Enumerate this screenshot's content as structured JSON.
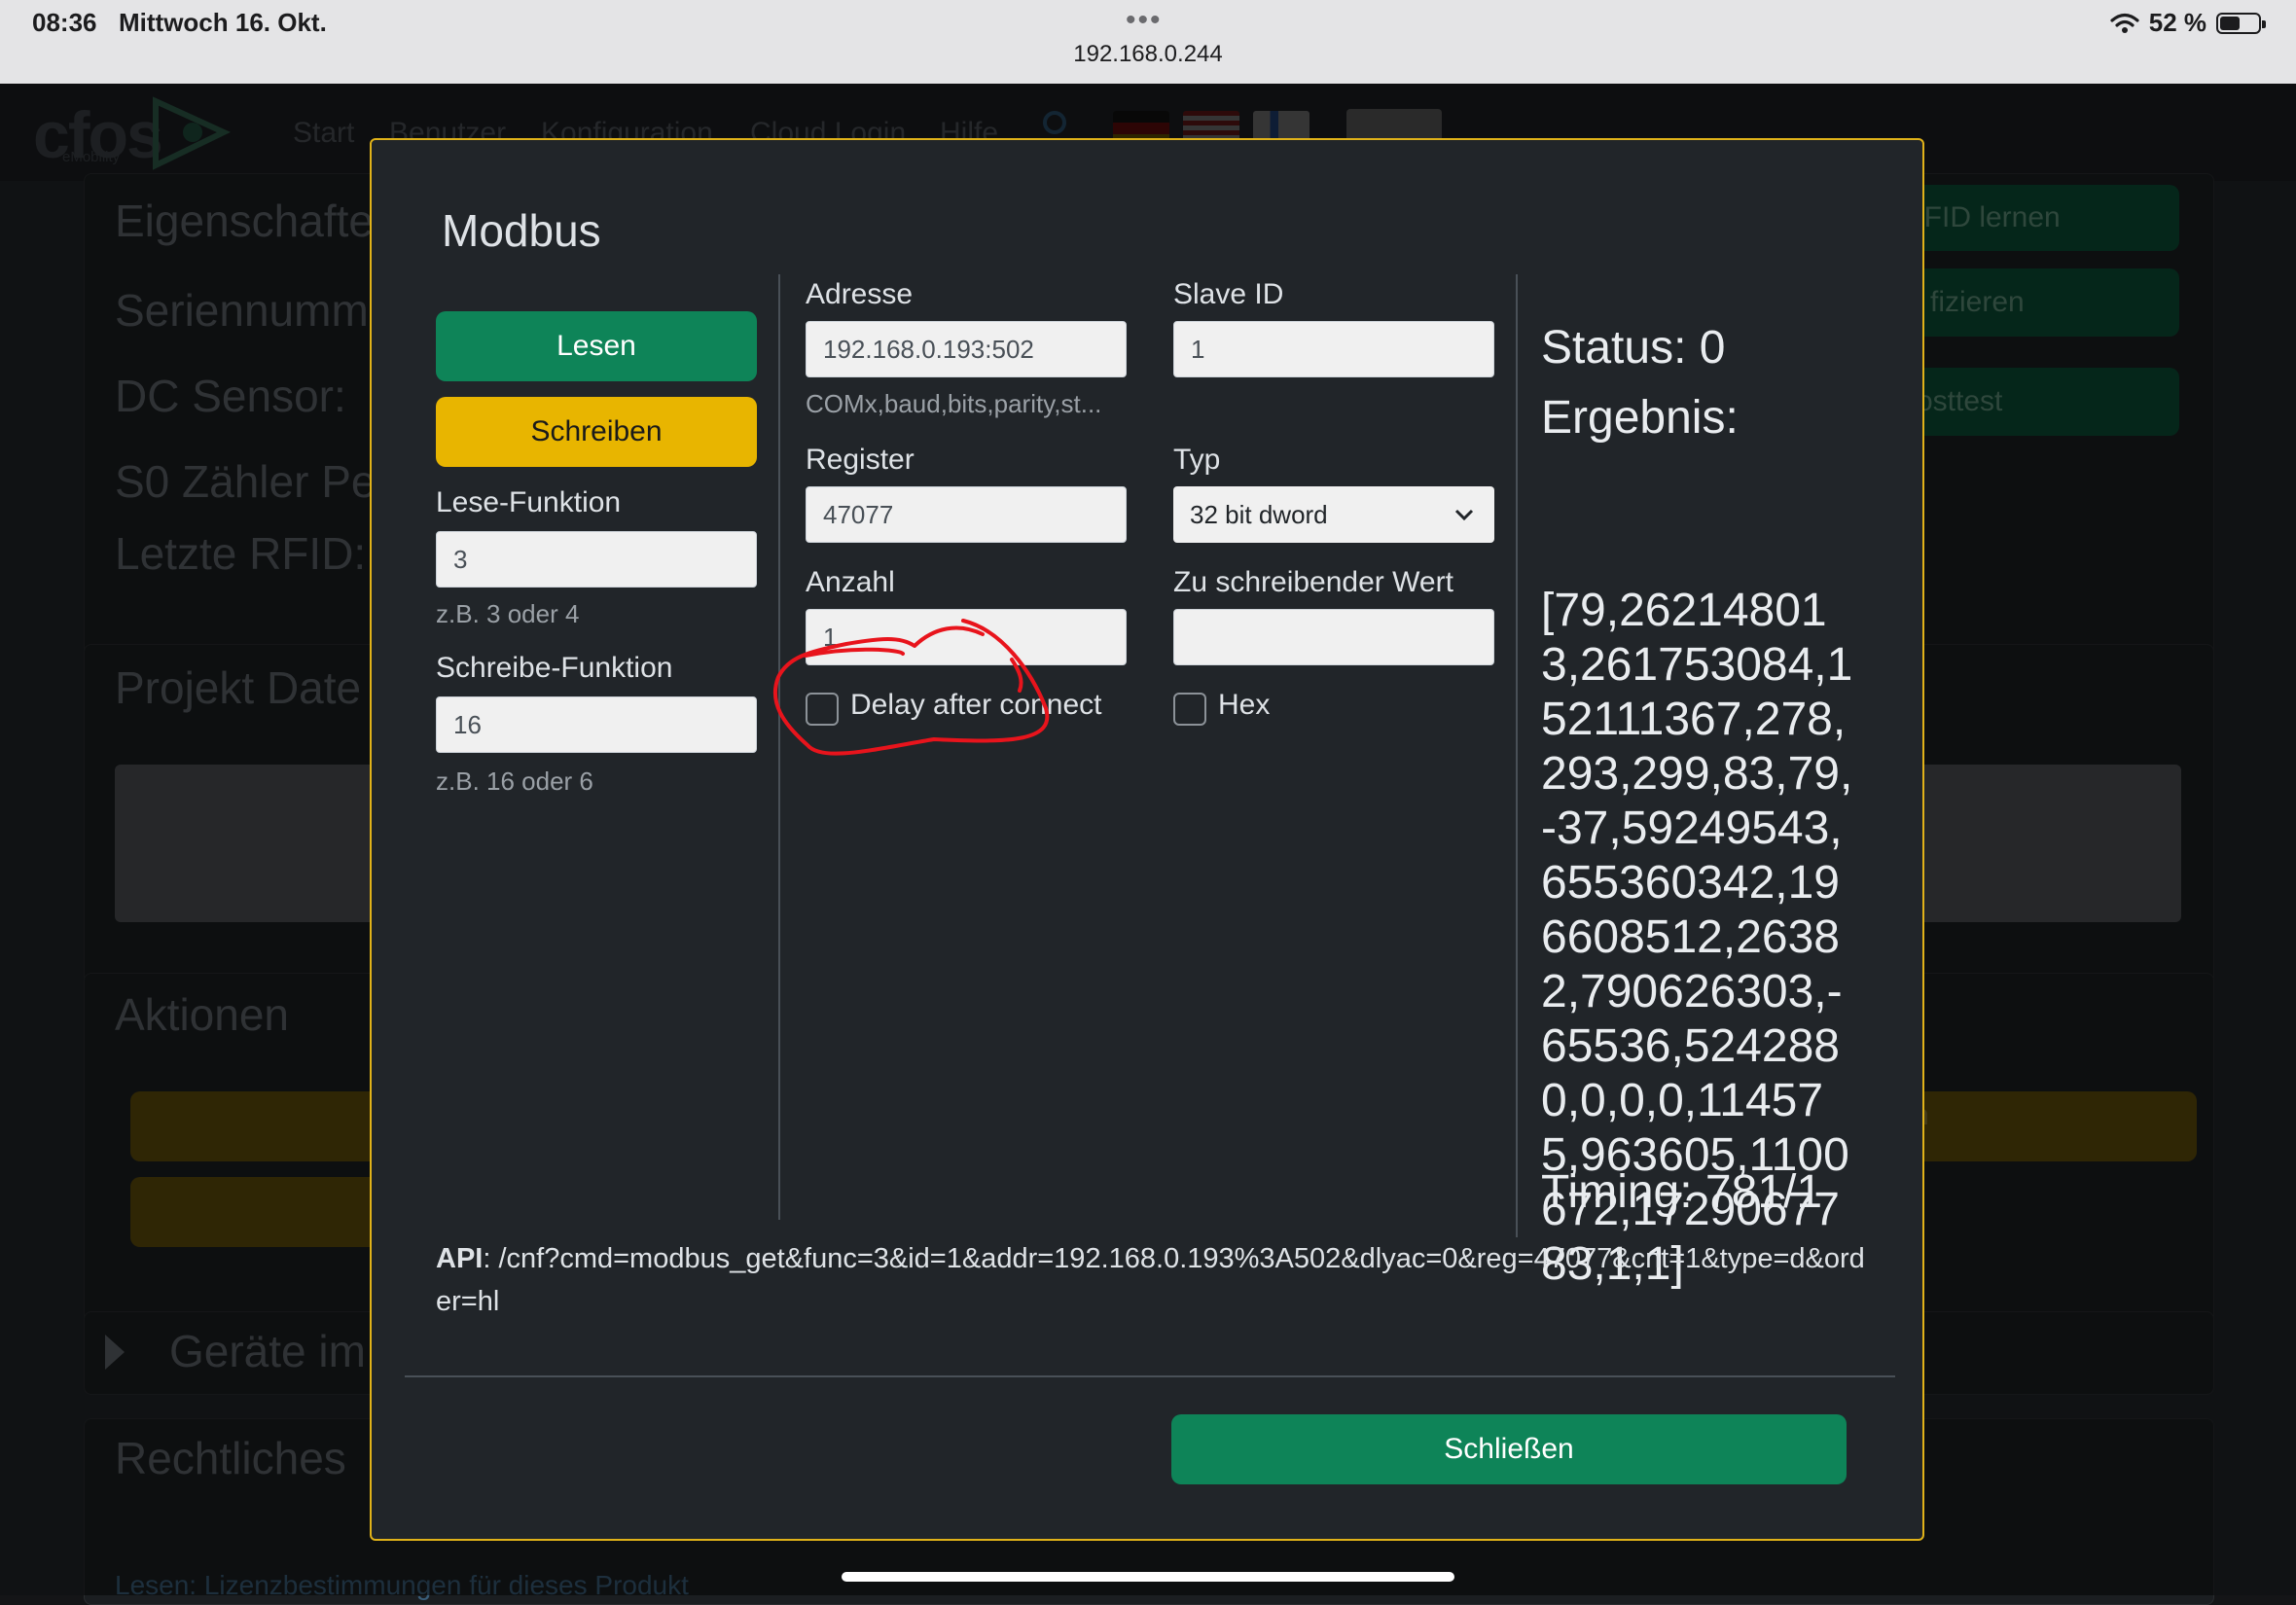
{
  "status_bar": {
    "time": "08:36",
    "date": "Mittwoch 16. Okt.",
    "url": "192.168.0.244",
    "battery_percent": "52 %",
    "battery_level": 0.52
  },
  "background": {
    "nav": [
      "Start",
      "Benutzer",
      "Konfiguration",
      "Cloud Login",
      "Hilfe"
    ],
    "rows": [
      "Eigenschafte",
      "Seriennumm",
      "DC Sensor:",
      "S0 Zähler Pe",
      "Letzte RFID:"
    ],
    "sections": [
      "Projekt Date",
      "Aktionen",
      "Geräte im",
      "Rechtliches"
    ],
    "right_buttons": [
      "RFID lernen",
      "fizieren",
      "osttest"
    ],
    "right_yellow": "n",
    "footer_link": "Lesen: Lizenzbestimmungen für dieses Produkt"
  },
  "modal": {
    "title": "Modbus",
    "read_button": "Lesen",
    "write_button": "Schreiben",
    "read_function": {
      "label": "Lese-Funktion",
      "value": "3",
      "hint": "z.B. 3 oder 4"
    },
    "write_function": {
      "label": "Schreibe-Funktion",
      "value": "16",
      "hint": "z.B. 16 oder 6"
    },
    "address": {
      "label": "Adresse",
      "value": "192.168.0.193:502",
      "hint": "COMx,baud,bits,parity,st..."
    },
    "slave_id": {
      "label": "Slave ID",
      "value": "1"
    },
    "register": {
      "label": "Register",
      "value": "47077"
    },
    "type": {
      "label": "Typ",
      "value": "32 bit dword"
    },
    "count": {
      "label": "Anzahl",
      "value": "1"
    },
    "write_value": {
      "label": "Zu schreibender Wert",
      "value": ""
    },
    "delay_after_connect": {
      "label": "Delay after connect",
      "checked": false
    },
    "hex": {
      "label": "Hex",
      "checked": false
    },
    "status": {
      "label": "Status:",
      "value": "0"
    },
    "result": {
      "label": "Ergebnis:",
      "value": "[79,262148013,261753084,152111367,278,293,299,83,79,-37,59249543,655360342,196608512,26382,790626303,-65536,5242880,0,0,0,114575,963605,1100672,1729067783,1,1]"
    },
    "timing": {
      "label": "Timing:",
      "value": "781/1"
    },
    "api": {
      "label": "API",
      "value": ": /cnf?cmd=modbus_get&func=3&id=1&addr=192.168.0.193%3A502&dlyac=0&reg=47077&cnt=1&type=d&order=hl"
    },
    "close_button": "Schließen"
  },
  "colors": {
    "accent_green": "#0e8458",
    "accent_yellow": "#e8b500",
    "modal_border": "#e0b219",
    "annotation_red": "#e8141c"
  }
}
